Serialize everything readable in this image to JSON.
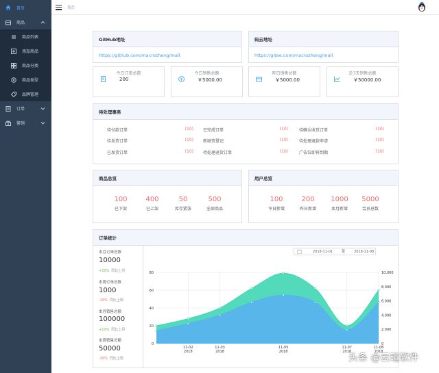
{
  "sidebar": {
    "items": [
      {
        "label": "首页",
        "icon": "home-icon",
        "active": true
      },
      {
        "label": "商品",
        "icon": "product-icon",
        "expanded": true
      },
      {
        "label": "订单",
        "icon": "order-icon"
      },
      {
        "label": "营销",
        "icon": "marketing-icon"
      }
    ],
    "sub_items": [
      {
        "label": "商品列表",
        "icon": "list-icon"
      },
      {
        "label": "添加商品",
        "icon": "add-icon"
      },
      {
        "label": "商品分类",
        "icon": "category-icon"
      },
      {
        "label": "商品类型",
        "icon": "type-icon"
      },
      {
        "label": "品牌管理",
        "icon": "brand-icon"
      }
    ]
  },
  "header": {
    "breadcrumb": "首页"
  },
  "github": {
    "title": "GitHub地址",
    "url": "https://github.com/macrozheng/mall"
  },
  "gitee": {
    "title": "码云地址",
    "url": "https://gitee.com/macrozheng/mall"
  },
  "stats": [
    {
      "label": "今日订单总数",
      "value": "200"
    },
    {
      "label": "今日销售总额",
      "value": "￥5000.00"
    },
    {
      "label": "昨日销售总额",
      "value": "￥5000.00"
    },
    {
      "label": "近7天销售总额",
      "value": "￥50000.00"
    }
  ],
  "todo": {
    "title": "待处理事务",
    "items": [
      {
        "label": "待付款订单",
        "count": "(10)"
      },
      {
        "label": "已完成订单",
        "count": "(10)"
      },
      {
        "label": "待确认收货订单",
        "count": "(10)"
      },
      {
        "label": "待发货订单",
        "count": "(10)"
      },
      {
        "label": "新缺货登记",
        "count": "(10)"
      },
      {
        "label": "待处理退款申请",
        "count": "(10)"
      },
      {
        "label": "已发货订单",
        "count": "(10)"
      },
      {
        "label": "待处理退货订单",
        "count": "(10)"
      },
      {
        "label": "广告位即将到期",
        "count": "(10)"
      }
    ]
  },
  "product_overview": {
    "title": "商品总览",
    "items": [
      {
        "value": "100",
        "label": "已下架"
      },
      {
        "value": "400",
        "label": "已上架"
      },
      {
        "value": "50",
        "label": "库存紧张"
      },
      {
        "value": "500",
        "label": "全部商品"
      }
    ]
  },
  "user_overview": {
    "title": "用户总览",
    "items": [
      {
        "value": "100",
        "label": "今日新增"
      },
      {
        "value": "200",
        "label": "昨日新增"
      },
      {
        "value": "1000",
        "label": "本月新增"
      },
      {
        "value": "5000",
        "label": "会员总数"
      }
    ]
  },
  "order_stats": {
    "title": "订单统计",
    "kpis": [
      {
        "label": "本月订单总数",
        "value": "10000",
        "delta": "+10%",
        "cmp": "同比上月",
        "up": true
      },
      {
        "label": "本周订单总数",
        "value": "1000",
        "delta": "-10%",
        "cmp": "同比上周",
        "up": false
      },
      {
        "label": "本月销售总额",
        "value": "100000",
        "delta": "+10%",
        "cmp": "同比上月",
        "up": true
      },
      {
        "label": "本周销售总额",
        "value": "50000",
        "delta": "-10%",
        "cmp": "同比上周",
        "up": false
      }
    ],
    "date_start": "2018-11-01",
    "date_sep": "至",
    "date_end": "2018-11-08"
  },
  "chart_data": {
    "type": "area",
    "x": [
      "2018-11-01",
      "2018-11-02",
      "2018-11-03",
      "2018-11-04",
      "2018-11-05",
      "2018-11-06",
      "2018-11-07",
      "2018-11-08"
    ],
    "x_tick_labels": [
      {
        "date": "11-02",
        "year": "2018",
        "index": 1
      },
      {
        "date": "11-03",
        "year": "2018",
        "index": 2
      },
      {
        "date": "11-05",
        "year": "2018",
        "index": 4
      },
      {
        "date": "11-07",
        "year": "2018",
        "index": 6
      },
      {
        "date": "11-08",
        "year": "2018",
        "index": 7
      }
    ],
    "series": [
      {
        "axis": "left",
        "color": "#3fd6b2",
        "values": [
          20,
          28,
          40,
          62,
          79,
          62,
          20,
          60
        ]
      },
      {
        "axis": "right",
        "color": "#5ab1ef",
        "values": [
          1800,
          2800,
          4000,
          5800,
          6800,
          5800,
          1900,
          5800
        ]
      }
    ],
    "ylim_left": [
      0,
      80
    ],
    "yticks_left": [
      "0",
      "20",
      "40",
      "60",
      "80"
    ],
    "ylim_right": [
      0,
      10000
    ],
    "yticks_right": [
      "0",
      "2,000",
      "4,000",
      "6,000",
      "8,000",
      "10,000"
    ],
    "grid": true
  },
  "watermark": "头条 @云瑄软件"
}
